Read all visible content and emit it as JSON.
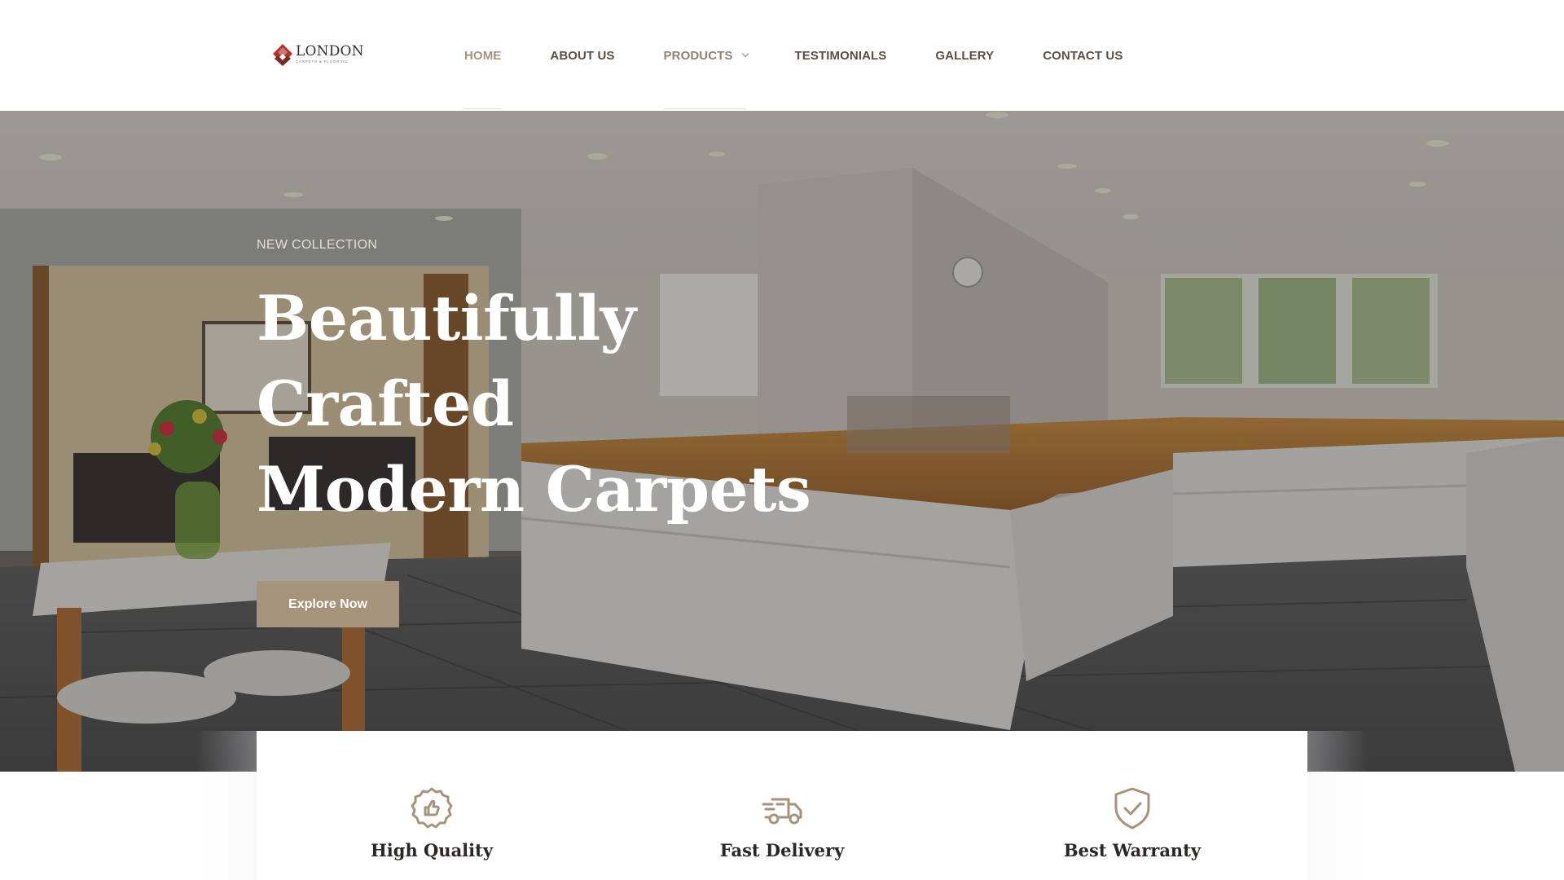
{
  "brand": {
    "name": "LONDON",
    "tagline": "CARPETS & FLOORING",
    "accent_color": "#a6937c",
    "logo_red": "#b0342a"
  },
  "nav": {
    "items": [
      {
        "label": "HOME",
        "state": "active"
      },
      {
        "label": "ABOUT US",
        "state": "default"
      },
      {
        "label": "PRODUCTS",
        "state": "hover",
        "has_dropdown": true,
        "icon": "chevron-down-icon"
      },
      {
        "label": "TESTIMONIALS",
        "state": "default"
      },
      {
        "label": "GALLERY",
        "state": "default"
      },
      {
        "label": "CONTACT US",
        "state": "default"
      }
    ]
  },
  "hero": {
    "eyebrow": "NEW COLLECTION",
    "title_line1": "Beautifully Crafted",
    "title_line2": "Modern Carpets",
    "cta_label": "Explore Now",
    "background": "kitchen-interior-photo"
  },
  "features": [
    {
      "title": "High Quality",
      "icon": "thumbs-up-badge-icon"
    },
    {
      "title": "Fast Delivery",
      "icon": "delivery-truck-icon"
    },
    {
      "title": "Best Warranty",
      "icon": "shield-check-icon"
    }
  ]
}
